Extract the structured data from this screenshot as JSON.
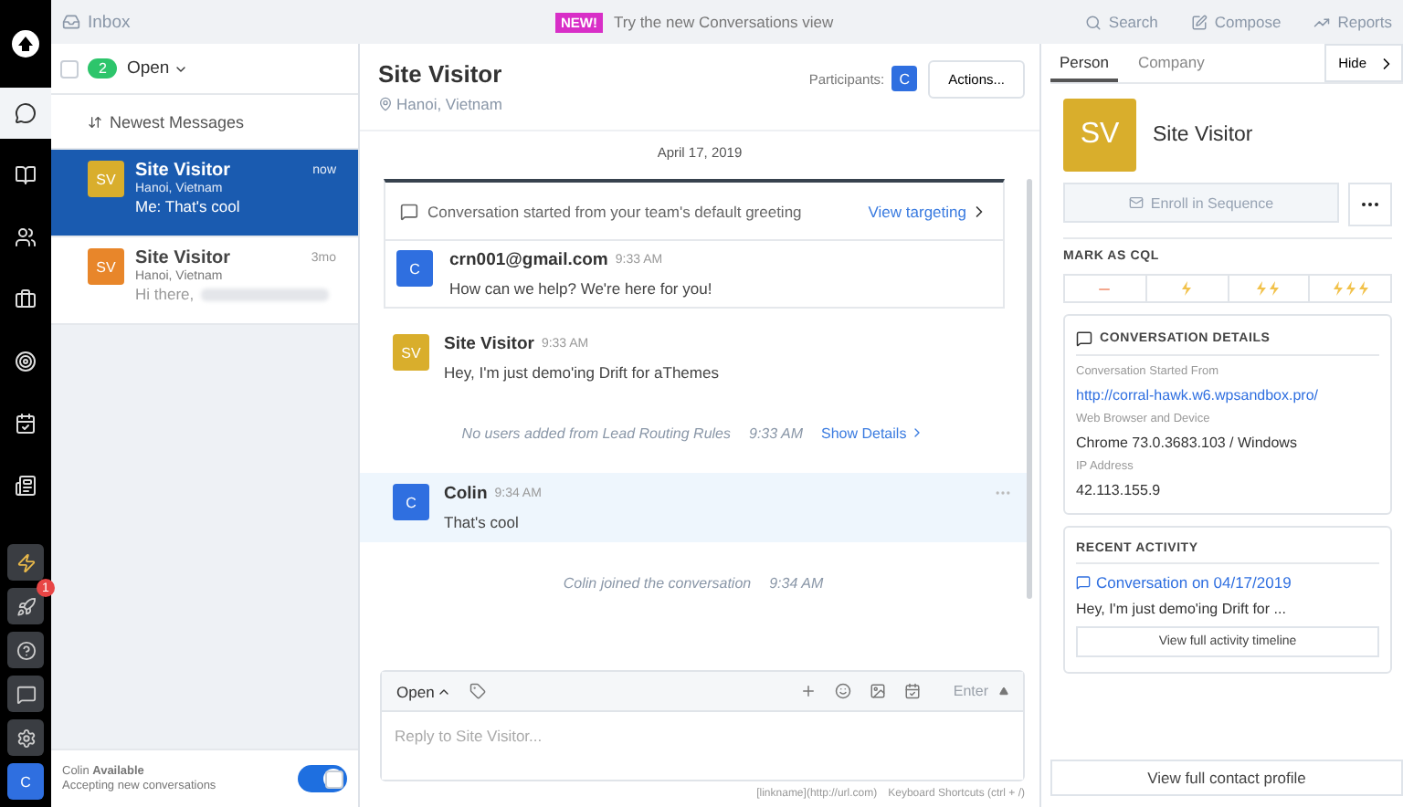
{
  "top_bar": {
    "title": "Inbox",
    "new_badge": "NEW!",
    "promo": "Try the new Conversations view",
    "actions": [
      "Search",
      "Compose",
      "Reports"
    ]
  },
  "nav_items": [
    {
      "selected": true
    },
    {
      "selected": false
    },
    {
      "selected": false
    },
    {
      "selected": false
    },
    {
      "selected": false
    },
    {
      "selected": false
    },
    {
      "selected": false
    }
  ],
  "rocket_badge": "1",
  "user_avatar": "C",
  "list": {
    "checked": false,
    "count": "2",
    "status": "Open",
    "sort": "Newest Messages",
    "conversations": [
      {
        "initials": "SV",
        "name": "Site Visitor",
        "location": "Hanoi, Vietnam",
        "time": "now",
        "preview": "Me: That's cool",
        "selected": true,
        "redacted": false,
        "color": "#d9ae2c"
      },
      {
        "initials": "SV",
        "name": "Site Visitor",
        "location": "Hanoi, Vietnam",
        "time": "3mo",
        "preview": "Hi there,",
        "selected": false,
        "redacted": true,
        "color": "#e8862a"
      }
    ],
    "agent": "Colin",
    "availability": "Available",
    "availability_note": "Accepting new conversations",
    "available": true
  },
  "conversation": {
    "title": "Site Visitor",
    "location": "Hanoi, Vietnam",
    "participants_label": "Participants:",
    "participant": "C",
    "actions": "Actions...",
    "date": "April 17, 2019",
    "thread": [
      {
        "kind": "greeting",
        "text": "Conversation started from your team's default greeting",
        "link": "View targeting",
        "initials": "C",
        "author": "crn001@gmail.com",
        "time": "9:33 AM",
        "body": "How can we help? We're here for you!"
      },
      {
        "kind": "message",
        "initials": "SV",
        "author": "Site Visitor",
        "time": "9:33 AM",
        "body": "Hey, I'm just demo'ing Drift for aThemes",
        "highlighted": false,
        "color": "#d9ae2c"
      },
      {
        "kind": "system",
        "text": "No users added from Lead Routing Rules",
        "time": "9:33 AM",
        "link": "Show Details"
      },
      {
        "kind": "message",
        "initials": "C",
        "author": "Colin",
        "time": "9:34 AM",
        "body": "That's cool",
        "highlighted": true,
        "color": "#2f6fe0"
      },
      {
        "kind": "system",
        "text": "Colin joined the conversation",
        "time": "9:34 AM"
      }
    ],
    "composer": {
      "status": "Open",
      "send": "Enter",
      "placeholder": "Reply to Site Visitor...",
      "hint_markdown": "[linkname](http://url.com)",
      "hint_shortcuts": "Keyboard Shortcuts (ctrl + /)"
    }
  },
  "profile": {
    "tabs": [
      {
        "label": "Person",
        "selected": true
      },
      {
        "label": "Company",
        "selected": false
      }
    ],
    "hide": "Hide",
    "initials": "SV",
    "name": "Site Visitor",
    "enroll": "Enroll in Sequence",
    "enroll_disabled": true,
    "cql_title": "MARK AS CQL",
    "details_title": "CONVERSATION DETAILS",
    "details": [
      {
        "label": "Conversation Started From",
        "value": "http://corral-hawk.w6.wpsandbox.pro/",
        "kind": "link"
      },
      {
        "label": "Web Browser and Device",
        "value": "Chrome 73.0.3683.103 / Windows",
        "kind": "text"
      },
      {
        "label": "IP Address",
        "value": "42.113.155.9",
        "kind": "text"
      }
    ],
    "activity_title": "RECENT ACTIVITY",
    "activity_link": "Conversation on 04/17/2019",
    "activity_preview": "Hey, I'm just demo'ing Drift for ...",
    "activity_button": "View full activity timeline",
    "profile_button": "View full contact profile"
  }
}
